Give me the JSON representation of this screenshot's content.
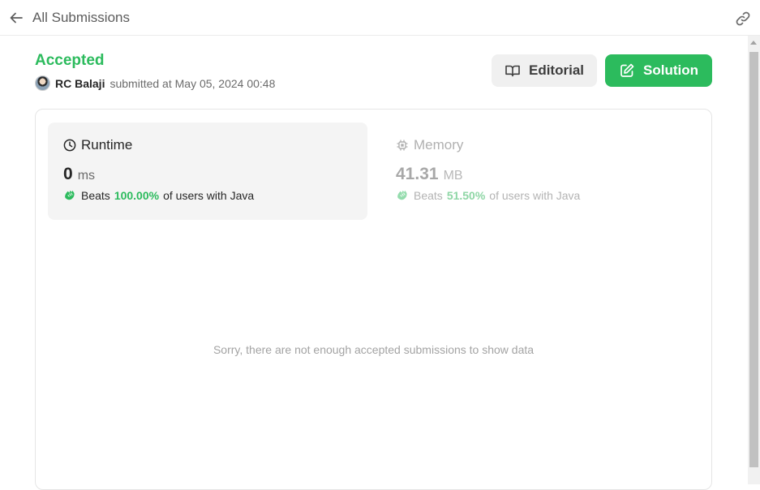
{
  "header": {
    "back_label": "All Submissions"
  },
  "submission": {
    "status": "Accepted",
    "status_color": "#2cbb5d",
    "author": "RC Balaji",
    "submitted_text": "submitted at May 05, 2024 00:48"
  },
  "actions": {
    "editorial_label": "Editorial",
    "solution_label": "Solution",
    "solution_color": "#2cbb5d"
  },
  "runtime": {
    "label": "Runtime",
    "value": "0",
    "unit": "ms",
    "beats_label": "Beats",
    "beats_percent": "100.00%",
    "beats_tail": "of users with Java"
  },
  "memory": {
    "label": "Memory",
    "value": "41.31",
    "unit": "MB",
    "beats_label": "Beats",
    "beats_percent": "51.50%",
    "beats_tail": "of users with Java"
  },
  "chart": {
    "empty_message": "Sorry, there are not enough accepted submissions to show data"
  },
  "icons": {
    "back": "arrow-left-icon",
    "link": "link-icon",
    "editorial": "book-icon",
    "solution": "edit-icon",
    "runtime": "clock-icon",
    "memory": "chip-icon",
    "beats": "clapping-hands-icon"
  }
}
